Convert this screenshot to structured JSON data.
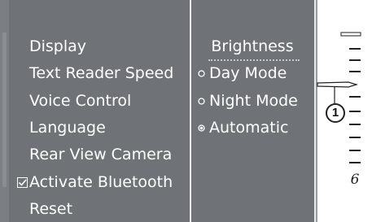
{
  "left_menu": {
    "items": [
      {
        "label": "Display",
        "checkbox": false
      },
      {
        "label": "Text Reader Speed",
        "checkbox": false
      },
      {
        "label": "Voice Control",
        "checkbox": false
      },
      {
        "label": "Language",
        "checkbox": false
      },
      {
        "label": "Rear View Camera",
        "checkbox": false
      },
      {
        "label": "Activate Bluetooth",
        "checkbox": true
      },
      {
        "label": "Reset",
        "checkbox": false
      }
    ]
  },
  "right_menu": {
    "heading": "Brightness",
    "options": [
      {
        "label": "Day Mode",
        "selected": false
      },
      {
        "label": "Night Mode",
        "selected": false
      },
      {
        "label": "Automatic",
        "selected": true
      }
    ]
  },
  "scale": {
    "tick_label": "6",
    "callout": "1"
  },
  "colors": {
    "screen_background": "#6f7377",
    "text": "#ffffff",
    "divider": "#e9e9e9"
  }
}
